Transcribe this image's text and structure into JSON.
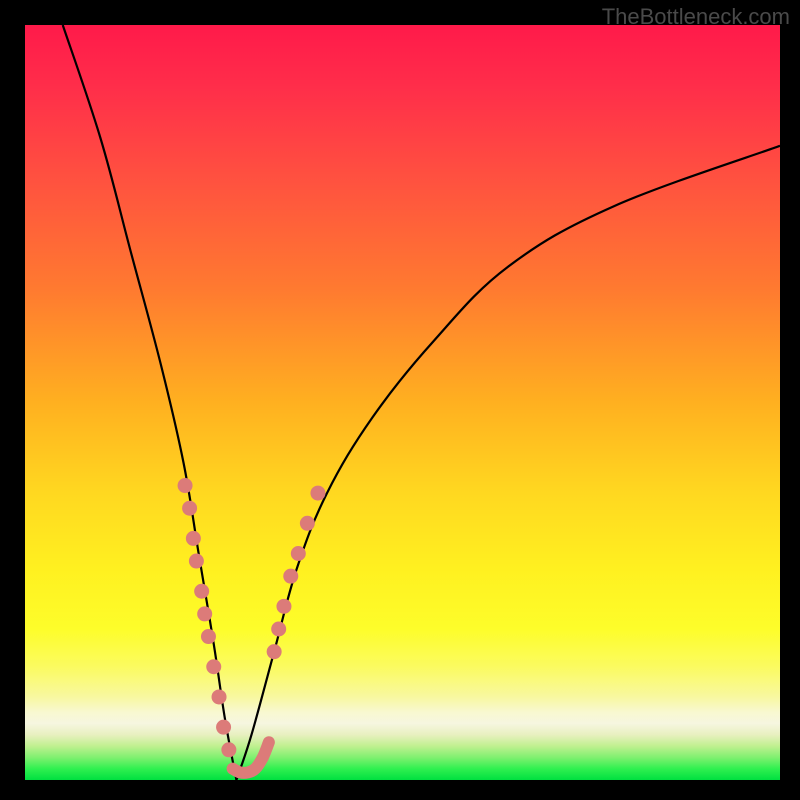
{
  "watermark": "TheBottleneck.com",
  "colors": {
    "dot_fill": "#dc7b79",
    "curve_stroke": "#000000",
    "background_outer": "#000000",
    "gradient_top": "#ff1a4a",
    "gradient_bottom": "#00e040"
  },
  "chart_data": {
    "type": "line",
    "title": "",
    "xlabel": "",
    "ylabel": "",
    "xlim": [
      0,
      100
    ],
    "ylim": [
      0,
      100
    ],
    "note": "V-shaped bottleneck curve; y read as 0 at bottom (green) → 100 at top (red). Minimum near x≈28.",
    "left_curve": [
      {
        "x": 5,
        "y": 100
      },
      {
        "x": 10,
        "y": 85
      },
      {
        "x": 14,
        "y": 70
      },
      {
        "x": 18,
        "y": 55
      },
      {
        "x": 21,
        "y": 42
      },
      {
        "x": 23,
        "y": 30
      },
      {
        "x": 25,
        "y": 18
      },
      {
        "x": 26.5,
        "y": 8
      },
      {
        "x": 28,
        "y": 0
      }
    ],
    "right_curve": [
      {
        "x": 28,
        "y": 0
      },
      {
        "x": 30,
        "y": 6
      },
      {
        "x": 33,
        "y": 17
      },
      {
        "x": 36,
        "y": 28
      },
      {
        "x": 40,
        "y": 38
      },
      {
        "x": 46,
        "y": 48
      },
      {
        "x": 54,
        "y": 58
      },
      {
        "x": 64,
        "y": 68
      },
      {
        "x": 78,
        "y": 76
      },
      {
        "x": 100,
        "y": 84
      }
    ],
    "highlight_points_left": [
      {
        "x": 21.2,
        "y": 39
      },
      {
        "x": 21.8,
        "y": 36
      },
      {
        "x": 22.3,
        "y": 32
      },
      {
        "x": 22.7,
        "y": 29
      },
      {
        "x": 23.4,
        "y": 25
      },
      {
        "x": 23.8,
        "y": 22
      },
      {
        "x": 24.3,
        "y": 19
      },
      {
        "x": 25.0,
        "y": 15
      },
      {
        "x": 25.7,
        "y": 11
      },
      {
        "x": 26.3,
        "y": 7
      },
      {
        "x": 27.0,
        "y": 4
      }
    ],
    "highlight_points_right": [
      {
        "x": 33.0,
        "y": 17
      },
      {
        "x": 33.6,
        "y": 20
      },
      {
        "x": 34.3,
        "y": 23
      },
      {
        "x": 35.2,
        "y": 27
      },
      {
        "x": 36.2,
        "y": 30
      },
      {
        "x": 37.4,
        "y": 34
      },
      {
        "x": 38.8,
        "y": 38
      }
    ],
    "bottom_run": [
      {
        "x": 27.5,
        "y": 1.5
      },
      {
        "x": 28.5,
        "y": 1.0
      },
      {
        "x": 29.5,
        "y": 1.0
      },
      {
        "x": 30.5,
        "y": 1.5
      },
      {
        "x": 31.5,
        "y": 3.0
      },
      {
        "x": 32.3,
        "y": 5.0
      }
    ]
  }
}
